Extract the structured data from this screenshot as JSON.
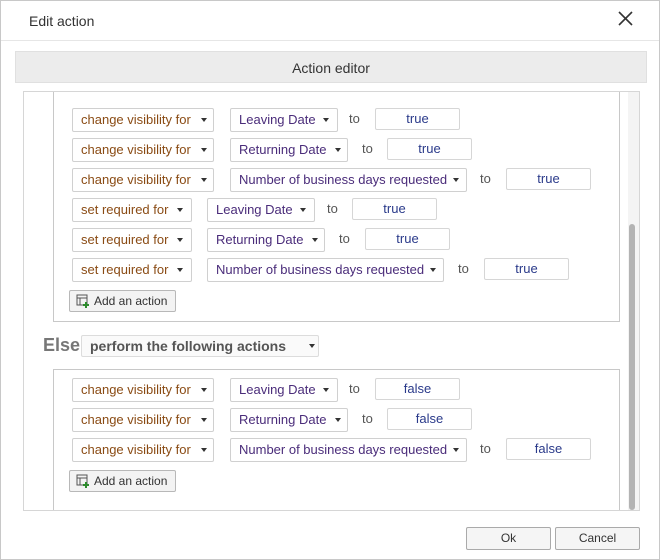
{
  "window": {
    "title": "Edit action",
    "close_icon": "close-icon"
  },
  "editor": {
    "header": "Action editor"
  },
  "then_actions": [
    {
      "action": "change visibility for",
      "field": "Leaving Date",
      "to": "to",
      "value": "true"
    },
    {
      "action": "change visibility for",
      "field": "Returning Date",
      "to": "to",
      "value": "true"
    },
    {
      "action": "change visibility for",
      "field": "Number of business days requested",
      "to": "to",
      "value": "true"
    },
    {
      "action": "set required for",
      "field": "Leaving Date",
      "to": "to",
      "value": "true"
    },
    {
      "action": "set required for",
      "field": "Returning Date",
      "to": "to",
      "value": "true"
    },
    {
      "action": "set required for",
      "field": "Number of business days requested",
      "to": "to",
      "value": "true"
    }
  ],
  "then_add_button": {
    "label": "Add an action",
    "icon": "add-action-icon"
  },
  "else_block": {
    "keyword": "Else",
    "mode": "perform the following actions"
  },
  "else_actions": [
    {
      "action": "change visibility for",
      "field": "Leaving Date",
      "to": "to",
      "value": "false"
    },
    {
      "action": "change visibility for",
      "field": "Returning Date",
      "to": "to",
      "value": "false"
    },
    {
      "action": "change visibility for",
      "field": "Number of business days requested",
      "to": "to",
      "value": "false"
    }
  ],
  "else_add_button": {
    "label": "Add an action",
    "icon": "add-action-icon"
  },
  "footer": {
    "ok_label": "Ok",
    "cancel_label": "Cancel"
  },
  "colors": {
    "action_text": "#8a4b14",
    "field_text": "#4a2c7a",
    "value_text": "#2a3a8a"
  }
}
